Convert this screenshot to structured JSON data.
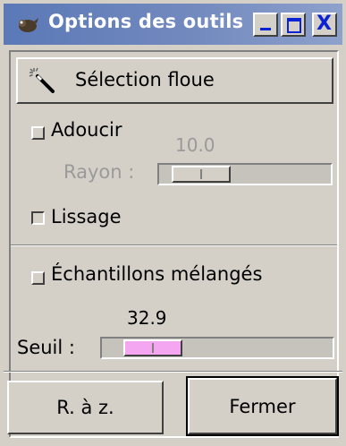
{
  "window": {
    "title": "Options des outils",
    "titlebar_colors": [
      "#5b79b7",
      "#8da1cc"
    ],
    "controls": {
      "minimize_icon": "minimize-icon",
      "maximize_icon": "maximize-icon",
      "close_icon": "close-icon",
      "close_glyph": "X"
    }
  },
  "tool": {
    "name": "Sélection floue",
    "icon": "magic-wand-icon"
  },
  "options": {
    "adoucir": {
      "label": "Adoucir",
      "checked": false
    },
    "rayon": {
      "label": "Rayon :",
      "value": "10.0",
      "enabled": false
    },
    "lissage": {
      "label": "Lissage",
      "checked": true
    },
    "echantillons": {
      "label": "Échantillons mélangés",
      "checked": false
    },
    "seuil": {
      "label": "Seuil :",
      "value": "32.9",
      "thumb_color": "#f5a6f0"
    }
  },
  "buttons": {
    "reset": "R. à z.",
    "close": "Fermer"
  }
}
